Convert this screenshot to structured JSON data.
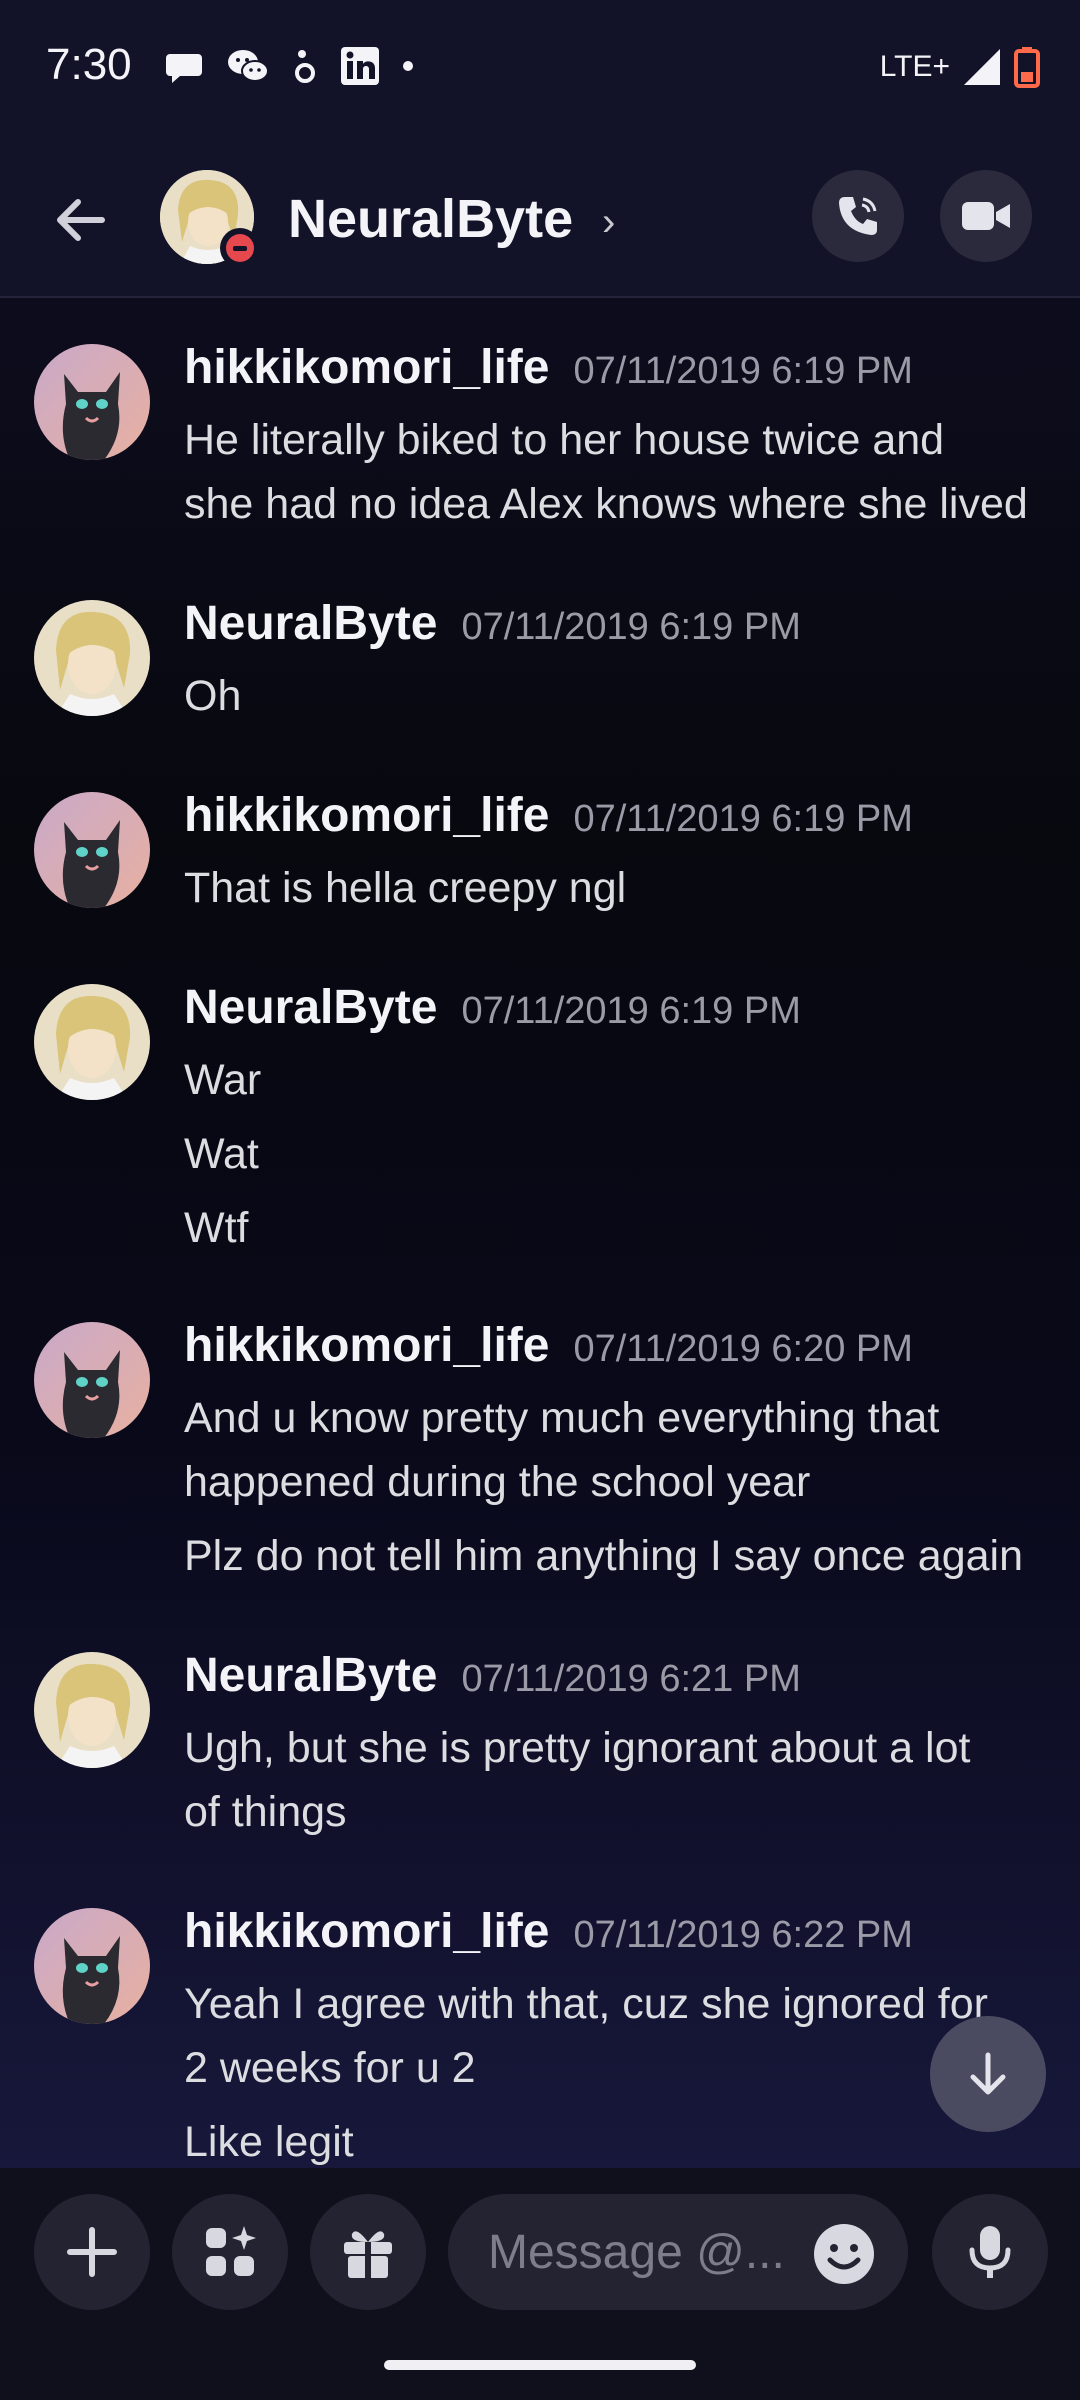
{
  "status_bar": {
    "time": "7:30",
    "network": "LTE+",
    "icons_left": [
      "chat-bubble-icon",
      "wechat-icon",
      "app-icon",
      "linkedin-icon",
      "dot-icon"
    ],
    "icons_right": [
      "signal-icon",
      "battery-icon"
    ]
  },
  "header": {
    "contact_name": "NeuralByte",
    "chevron": "›",
    "status": "do-not-disturb",
    "actions": [
      "call-icon",
      "video-icon"
    ]
  },
  "messages": [
    {
      "author": "hikkikomori_life",
      "timestamp": "07/11/2019 6:19 PM",
      "lines": [
        "He literally biked to her house twice and",
        "she had no idea Alex knows where she lived"
      ]
    },
    {
      "author": "NeuralByte",
      "timestamp": "07/11/2019 6:19 PM",
      "lines": [
        "Oh"
      ]
    },
    {
      "author": "hikkikomori_life",
      "timestamp": "07/11/2019 6:19 PM",
      "lines": [
        "That is hella creepy ngl"
      ]
    },
    {
      "author": "NeuralByte",
      "timestamp": "07/11/2019 6:19 PM",
      "lines": [
        "War",
        "Wat",
        "Wtf"
      ]
    },
    {
      "author": "hikkikomori_life",
      "timestamp": "07/11/2019 6:20 PM",
      "lines": [
        "And u know pretty much everything that",
        "happened during the school year",
        "Plz do not tell him anything I say once again"
      ]
    },
    {
      "author": "NeuralByte",
      "timestamp": "07/11/2019 6:21 PM",
      "lines": [
        "Ugh, but she is pretty ignorant about a lot",
        "of things"
      ]
    },
    {
      "author": "hikkikomori_life",
      "timestamp": "07/11/2019 6:22 PM",
      "lines": [
        "Yeah I agree with that, cuz she ignored for",
        "2 weeks for u 2",
        "Like legit"
      ]
    }
  ],
  "composer": {
    "placeholder": "Message @...",
    "buttons": [
      "add-icon",
      "apps-icon",
      "gift-icon",
      "emoji-icon",
      "microphone-icon"
    ]
  },
  "colors": {
    "background_top": "#0f0f25",
    "background_bottom": "#1c1c46",
    "dnd_red": "#e5484d",
    "timestamp_gray": "#9a9ba6"
  }
}
